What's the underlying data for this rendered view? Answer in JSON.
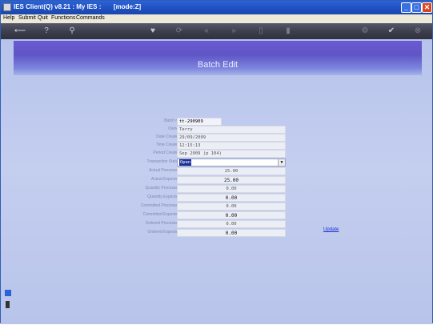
{
  "window": {
    "title": "IES Client(Q) v8.21 : My IES :       [mode:Z]",
    "min_glyph": "_",
    "max_glyph": "□",
    "close_glyph": "✕"
  },
  "menu": [
    "Help",
    "Submit",
    "Quit",
    "Functions",
    "Commands"
  ],
  "toolbar_icons": [
    {
      "name": "back-arrow-icon",
      "glyph": "⟵"
    },
    {
      "name": "help-icon",
      "glyph": "?"
    },
    {
      "name": "search-icon",
      "glyph": "⚲"
    },
    {
      "name": "heart-icon",
      "glyph": "♥"
    },
    {
      "name": "refresh-icon",
      "glyph": "⟳"
    },
    {
      "name": "previous-icon",
      "glyph": "«"
    },
    {
      "name": "next-icon",
      "glyph": "»"
    },
    {
      "name": "doc-icon",
      "glyph": "▯"
    },
    {
      "name": "delete-icon",
      "glyph": "▮"
    },
    {
      "name": "settings-icon",
      "glyph": "⚙"
    },
    {
      "name": "check-icon",
      "glyph": "✔"
    },
    {
      "name": "cancel-icon",
      "glyph": "⊗"
    }
  ],
  "page": {
    "title": "Batch Edit",
    "update_label": "Update"
  },
  "form": {
    "batch_no": {
      "label": "Batch no",
      "value": "tt-290909"
    },
    "owner": {
      "label": "Owner",
      "value": "Terry"
    },
    "date_created": {
      "label": "Date Created",
      "value": "29/09/2009"
    },
    "time_created": {
      "label": "Time Created",
      "value": "  12:15:13"
    },
    "period_created": {
      "label": "Period Created",
      "value": "Sep 2009 (p 104)"
    },
    "transaction_status": {
      "label": "Transaction Status",
      "value": "Open"
    },
    "actual_processed": {
      "label": "Actual Processed",
      "value": "25.00"
    },
    "actual_expected": {
      "label": "Actual Expected",
      "value": "25.00"
    },
    "quantity_processed": {
      "label": "Quantity Processed",
      "value": "0.00"
    },
    "quantity_expected": {
      "label": "Quantity Expected",
      "value": "0.00"
    },
    "committed_processed": {
      "label": "Committed Processed",
      "value": "0.00"
    },
    "committed_expected": {
      "label": "Committed Expected",
      "value": "0.00"
    },
    "ordered_processed": {
      "label": "Ordered Processed",
      "value": "0.00"
    },
    "ordered_expected": {
      "label": "Ordered Expected",
      "value": "0.00"
    }
  },
  "colors": {
    "title_bar": "#1f4fbf",
    "header_band": "#6b5bd1",
    "content_bg": "#b7c3ec",
    "link": "#1b2fd0"
  }
}
